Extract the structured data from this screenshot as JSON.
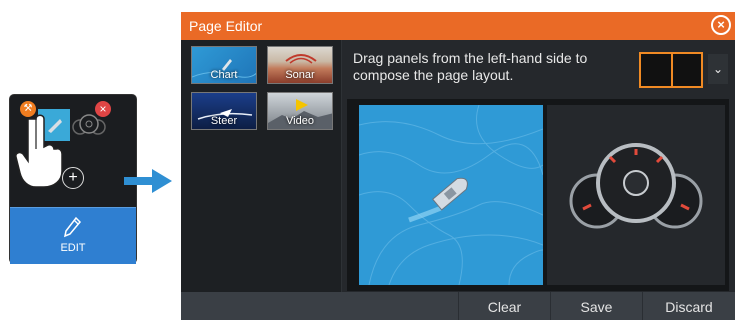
{
  "tile": {
    "edit_label": "EDIT"
  },
  "editor": {
    "title": "Page Editor",
    "instruction": "Drag panels from the left-hand side to compose the page layout.",
    "panels": [
      {
        "label": "Chart"
      },
      {
        "label": "Sonar"
      },
      {
        "label": "Steer"
      },
      {
        "label": "Video"
      }
    ],
    "footer": {
      "clear": "Clear",
      "save": "Save",
      "discard": "Discard"
    }
  },
  "colors": {
    "accent": "#ea6a26",
    "highlight": "#2f7fd1",
    "chart_water": "#2f9ad6",
    "close_badge": "#e04545"
  }
}
